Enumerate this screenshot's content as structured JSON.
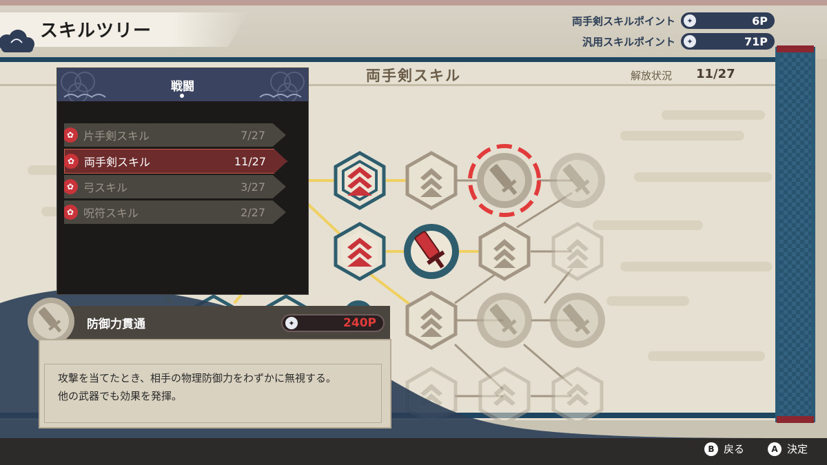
{
  "header": {
    "title": "スキルツリー",
    "points": [
      {
        "label": "両手剣スキルポイント",
        "value": "6P"
      },
      {
        "label": "汎用スキルポイント",
        "value": "71P"
      }
    ]
  },
  "board": {
    "title": "両手剣スキル",
    "progress_label": "解放状況",
    "progress_value": "11/27"
  },
  "category_panel": {
    "title": "戦闘",
    "items": [
      {
        "label": "片手剣スキル",
        "count": "7/27",
        "selected": false
      },
      {
        "label": "両手剣スキル",
        "count": "11/27",
        "selected": true
      },
      {
        "label": "弓スキル",
        "count": "3/27",
        "selected": false
      },
      {
        "label": "呪符スキル",
        "count": "2/27",
        "selected": false
      }
    ]
  },
  "skill_info": {
    "name": "防御力貫通",
    "cost": "240P",
    "description": [
      "攻撃を当てたとき、相手の物理防御力をわずかに無視する。",
      "他の武器でも効果を発揮。"
    ]
  },
  "footer": {
    "back": {
      "key": "B",
      "label": "戻る"
    },
    "confirm": {
      "key": "A",
      "label": "決定"
    }
  },
  "colors": {
    "accent_red": "#c9333a",
    "navy": "#2f3d57",
    "teal": "#2e5d6e",
    "gold_line": "#f0d060"
  }
}
